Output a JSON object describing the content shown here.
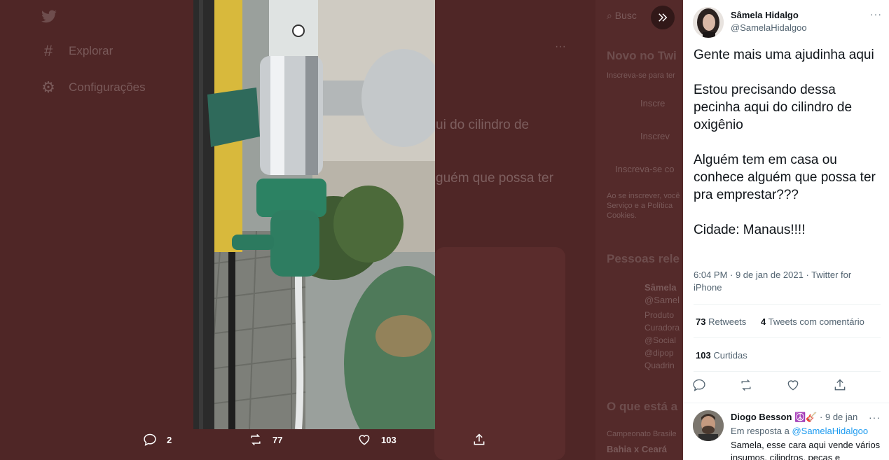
{
  "background": {
    "nav": [
      "Explorar",
      "Configurações"
    ],
    "text_snippets": [
      "ui do cilindro de",
      "guém que possa ter"
    ],
    "right_column": {
      "search_placeholder": "Busc",
      "new_heading": "Novo no Twi",
      "signup_hint": "Inscreva-se para ter",
      "google_btn": "Inscre",
      "apple_btn": "Inscrev",
      "signup_link": "Inscreva-se co",
      "terms_1": "Ao se inscrever, você",
      "terms_2": "Serviço e a Política",
      "terms_3": "Cookies.",
      "people_heading": "Pessoas rele",
      "person_name": "Sâmela",
      "person_handle": "@Samel",
      "person_bio": [
        "Produto",
        "Curadora",
        "@Social",
        "@dipop",
        "Quadrin"
      ],
      "trends_heading": "O que está a",
      "trend_cat": "Campeonato Brasile",
      "trend_name": "Bahia x Ceará"
    }
  },
  "media_actions": {
    "replies": "2",
    "retweets": "77",
    "likes": "103"
  },
  "tweet": {
    "author_name": "Sâmela Hidalgo",
    "author_handle": "@SamelaHidalgoo",
    "more": "···",
    "text": "Gente mais uma ajudinha aqui\n\nEstou precisando dessa pecinha aqui do cilindro de oxigênio\n\nAlguém tem em casa ou conhece alguém que possa ter pra emprestar???\n\nCidade: Manaus!!!!",
    "meta": "6:04 PM · 9 de jan de 2021 · Twitter for iPhone",
    "retweets_count": "73",
    "retweets_label": "Retweets",
    "quotes_count": "4",
    "quotes_label": "Tweets com comentário",
    "likes_count": "103",
    "likes_label": "Curtidas"
  },
  "reply": {
    "author_name": "Diogo Besson",
    "emoji": "☮️🎸",
    "time": "· 9 de jan",
    "reply_to_prefix": "Em resposta a",
    "reply_to_handle": "@SamelaHidalgoo",
    "text": "Samela, esse cara aqui vende vários insumos, cilindros, peças e"
  },
  "colors": {
    "overlay": "#4f2626",
    "accent": "#1d9bf0",
    "text_secondary": "#536471"
  }
}
